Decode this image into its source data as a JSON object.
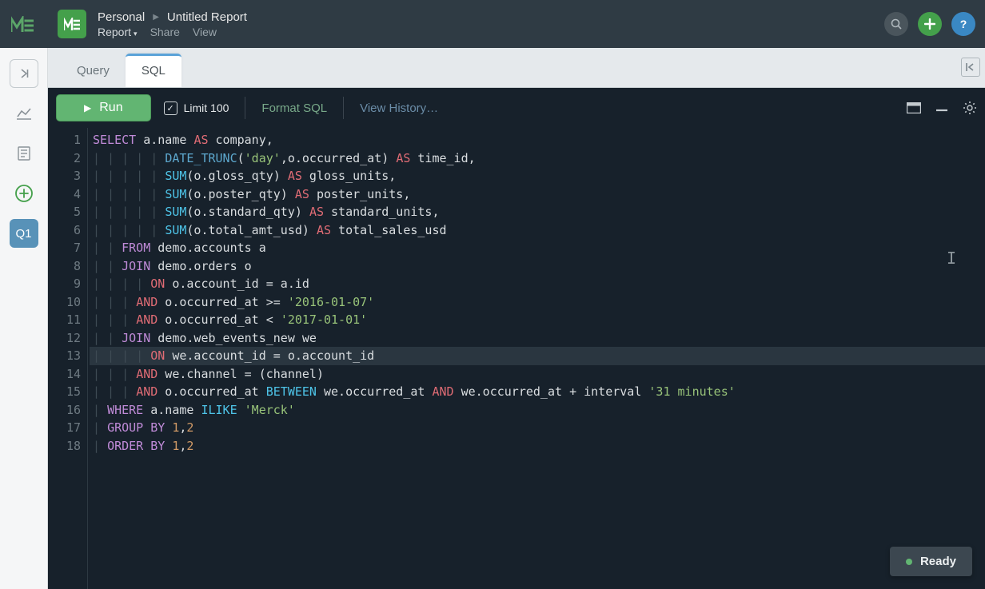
{
  "header": {
    "breadcrumb_workspace": "Personal",
    "breadcrumb_title": "Untitled Report",
    "menu": {
      "report": "Report",
      "share": "Share",
      "view": "View"
    }
  },
  "rail": {
    "q1_label": "Q1"
  },
  "tabs": {
    "query": "Query",
    "sql": "SQL"
  },
  "toolbar": {
    "run_label": "Run",
    "limit_label": "Limit 100",
    "format_sql": "Format SQL",
    "view_history": "View History…"
  },
  "status": {
    "ready": "Ready"
  },
  "code": {
    "lines": [
      {
        "n": 1,
        "indent": 0,
        "tokens": [
          [
            "kw-sel",
            "SELECT"
          ],
          [
            "ident",
            " a.name "
          ],
          [
            "kw-as",
            "AS"
          ],
          [
            "ident",
            " company,"
          ]
        ]
      },
      {
        "n": 2,
        "indent": 5,
        "tokens": [
          [
            "fn-blue",
            "DATE_TRUNC"
          ],
          [
            "ident",
            "("
          ],
          [
            "str",
            "'day'"
          ],
          [
            "ident",
            ",o.occurred_at) "
          ],
          [
            "kw-as",
            "AS"
          ],
          [
            "ident",
            " time_id,"
          ]
        ]
      },
      {
        "n": 3,
        "indent": 5,
        "tokens": [
          [
            "kw-func",
            "SUM"
          ],
          [
            "ident",
            "(o.gloss_qty) "
          ],
          [
            "kw-as",
            "AS"
          ],
          [
            "ident",
            " gloss_units,"
          ]
        ]
      },
      {
        "n": 4,
        "indent": 5,
        "tokens": [
          [
            "kw-func",
            "SUM"
          ],
          [
            "ident",
            "(o.poster_qty) "
          ],
          [
            "kw-as",
            "AS"
          ],
          [
            "ident",
            " poster_units,"
          ]
        ]
      },
      {
        "n": 5,
        "indent": 5,
        "tokens": [
          [
            "kw-func",
            "SUM"
          ],
          [
            "ident",
            "(o.standard_qty) "
          ],
          [
            "kw-as",
            "AS"
          ],
          [
            "ident",
            " standard_units,"
          ]
        ]
      },
      {
        "n": 6,
        "indent": 5,
        "tokens": [
          [
            "kw-func",
            "SUM"
          ],
          [
            "ident",
            "(o.total_amt_usd) "
          ],
          [
            "kw-as",
            "AS"
          ],
          [
            "ident",
            " total_sales_usd"
          ]
        ]
      },
      {
        "n": 7,
        "indent": 2,
        "tokens": [
          [
            "kw-sel",
            "FROM"
          ],
          [
            "ident",
            " demo.accounts a"
          ]
        ]
      },
      {
        "n": 8,
        "indent": 2,
        "tokens": [
          [
            "kw-sel",
            "JOIN"
          ],
          [
            "ident",
            " demo.orders o"
          ]
        ]
      },
      {
        "n": 9,
        "indent": 4,
        "tokens": [
          [
            "kw-as",
            "ON"
          ],
          [
            "ident",
            " o.account_id "
          ],
          [
            "op",
            "="
          ],
          [
            "ident",
            " a.id"
          ]
        ]
      },
      {
        "n": 10,
        "indent": 3,
        "tokens": [
          [
            "kw-as",
            "AND"
          ],
          [
            "ident",
            " o.occurred_at "
          ],
          [
            "op",
            ">="
          ],
          [
            "ident",
            " "
          ],
          [
            "str",
            "'2016-01-07'"
          ]
        ]
      },
      {
        "n": 11,
        "indent": 3,
        "tokens": [
          [
            "kw-as",
            "AND"
          ],
          [
            "ident",
            " o.occurred_at "
          ],
          [
            "op",
            "<"
          ],
          [
            "ident",
            " "
          ],
          [
            "str",
            "'2017-01-01'"
          ]
        ]
      },
      {
        "n": 12,
        "indent": 2,
        "tokens": [
          [
            "kw-sel",
            "JOIN"
          ],
          [
            "ident",
            " demo.web_events_new we"
          ]
        ]
      },
      {
        "n": 13,
        "indent": 4,
        "hl": true,
        "tokens": [
          [
            "kw-as",
            "ON"
          ],
          [
            "ident",
            " we.account_id "
          ],
          [
            "op",
            "="
          ],
          [
            "ident",
            " o.account_id"
          ]
        ]
      },
      {
        "n": 14,
        "indent": 3,
        "tokens": [
          [
            "kw-as",
            "AND"
          ],
          [
            "ident",
            " we.channel "
          ],
          [
            "op",
            "="
          ],
          [
            "ident",
            " (channel)"
          ]
        ]
      },
      {
        "n": 15,
        "indent": 3,
        "tokens": [
          [
            "kw-as",
            "AND"
          ],
          [
            "ident",
            " o.occurred_at "
          ],
          [
            "kw-func",
            "BETWEEN"
          ],
          [
            "ident",
            " we.occurred_at "
          ],
          [
            "kw-as",
            "AND"
          ],
          [
            "ident",
            " we.occurred_at "
          ],
          [
            "op",
            "+"
          ],
          [
            "ident",
            " interval "
          ],
          [
            "str",
            "'31 minutes'"
          ]
        ]
      },
      {
        "n": 16,
        "indent": 1,
        "tokens": [
          [
            "kw-sel",
            "WHERE"
          ],
          [
            "ident",
            " a.name "
          ],
          [
            "kw-func",
            "ILIKE"
          ],
          [
            "ident",
            " "
          ],
          [
            "str",
            "'Merck'"
          ]
        ]
      },
      {
        "n": 17,
        "indent": 1,
        "tokens": [
          [
            "kw-sel",
            "GROUP"
          ],
          [
            "ident",
            " "
          ],
          [
            "kw-sel",
            "BY"
          ],
          [
            "ident",
            " "
          ],
          [
            "num",
            "1"
          ],
          [
            "ident",
            ","
          ],
          [
            "num",
            "2"
          ]
        ]
      },
      {
        "n": 18,
        "indent": 1,
        "tokens": [
          [
            "kw-sel",
            "ORDER"
          ],
          [
            "ident",
            " "
          ],
          [
            "kw-sel",
            "BY"
          ],
          [
            "ident",
            " "
          ],
          [
            "num",
            "1"
          ],
          [
            "ident",
            ","
          ],
          [
            "num",
            "2"
          ]
        ]
      }
    ]
  }
}
